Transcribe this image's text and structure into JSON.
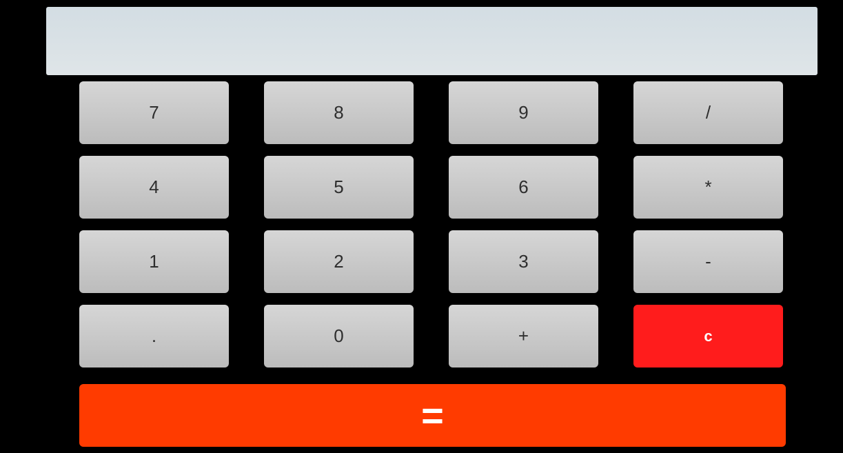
{
  "display": {
    "value": ""
  },
  "keys": [
    {
      "label": "7",
      "name": "key-7"
    },
    {
      "label": "8",
      "name": "key-8"
    },
    {
      "label": "9",
      "name": "key-9"
    },
    {
      "label": "/",
      "name": "key-divide"
    },
    {
      "label": "4",
      "name": "key-4"
    },
    {
      "label": "5",
      "name": "key-5"
    },
    {
      "label": "6",
      "name": "key-6"
    },
    {
      "label": "*",
      "name": "key-multiply"
    },
    {
      "label": "1",
      "name": "key-1"
    },
    {
      "label": "2",
      "name": "key-2"
    },
    {
      "label": "3",
      "name": "key-3"
    },
    {
      "label": "-",
      "name": "key-subtract"
    },
    {
      "label": ".",
      "name": "key-decimal"
    },
    {
      "label": "0",
      "name": "key-0"
    },
    {
      "label": "+",
      "name": "key-add"
    },
    {
      "label": "c",
      "name": "clear-button"
    }
  ],
  "equals": {
    "label": "="
  },
  "colors": {
    "background": "#000000",
    "display": "#d9e1e5",
    "key": "#c8c8c8",
    "clear": "#ff1c1c",
    "equals": "#ff3b00"
  }
}
